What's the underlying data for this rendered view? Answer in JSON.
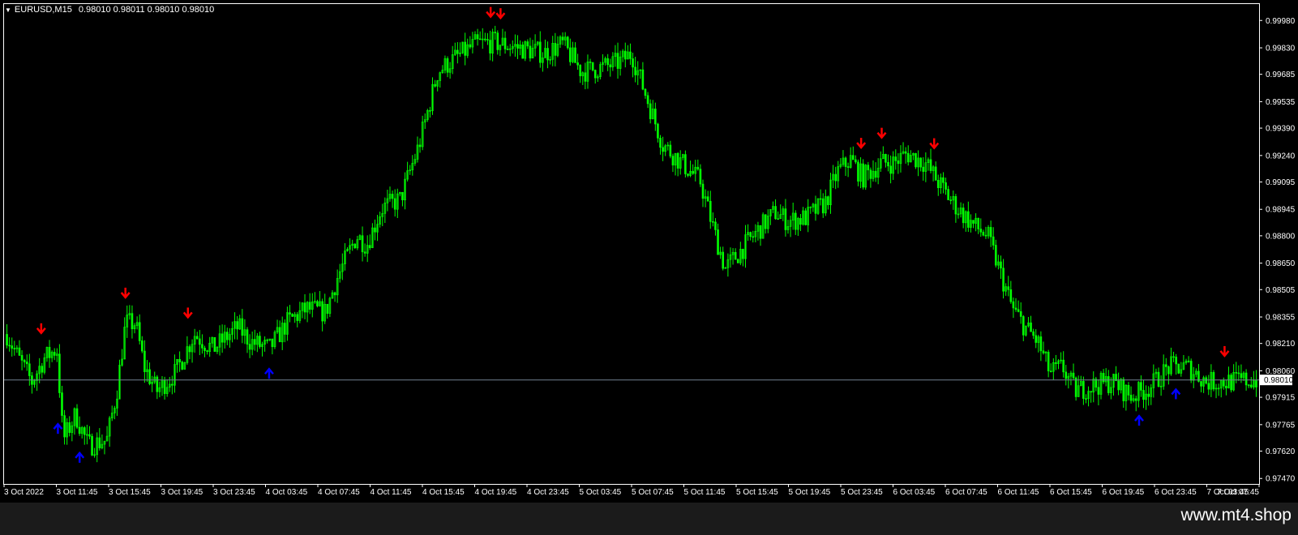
{
  "header": {
    "symbol_tf": "EURUSD,M15",
    "ohlc": "0.98010 0.98011 0.98010 0.98010"
  },
  "watermark": "www.mt4.shop",
  "colors": {
    "background": "#000000",
    "candle": "#00ff00",
    "sell_arrow": "#ff0000",
    "buy_arrow": "#0000ff",
    "current_line": "#708090",
    "axis": "#ffffff"
  },
  "chart_data": {
    "type": "candlestick",
    "current_price_label": "0.98010",
    "current_price": 0.9801,
    "ylim": [
      0.9744,
      1.0007
    ],
    "y_ticks": [
      "0.99980",
      "0.99830",
      "0.99685",
      "0.99535",
      "0.99390",
      "0.99240",
      "0.99095",
      "0.98945",
      "0.98800",
      "0.98650",
      "0.98505",
      "0.98355",
      "0.98210",
      "0.98060",
      "0.97915",
      "0.97765",
      "0.97620",
      "0.97470"
    ],
    "x_ticks": [
      "3 Oct 2022",
      "3 Oct 11:45",
      "3 Oct 15:45",
      "3 Oct 19:45",
      "3 Oct 23:45",
      "4 Oct 03:45",
      "4 Oct 07:45",
      "4 Oct 11:45",
      "4 Oct 15:45",
      "4 Oct 19:45",
      "4 Oct 23:45",
      "5 Oct 03:45",
      "5 Oct 07:45",
      "5 Oct 11:45",
      "5 Oct 15:45",
      "5 Oct 19:45",
      "5 Oct 23:45",
      "6 Oct 03:45",
      "6 Oct 07:45",
      "6 Oct 11:45",
      "6 Oct 15:45",
      "6 Oct 19:45",
      "6 Oct 23:45",
      "7 Oct 03:45",
      "7 Oct 07:45"
    ],
    "price_path": [
      [
        0.0,
        0.9826
      ],
      [
        0.01,
        0.9812
      ],
      [
        0.02,
        0.98
      ],
      [
        0.03,
        0.9813
      ],
      [
        0.04,
        0.9818
      ],
      [
        0.045,
        0.9768
      ],
      [
        0.055,
        0.9782
      ],
      [
        0.065,
        0.9765
      ],
      [
        0.08,
        0.9768
      ],
      [
        0.088,
        0.9795
      ],
      [
        0.095,
        0.9832
      ],
      [
        0.103,
        0.9832
      ],
      [
        0.11,
        0.9808
      ],
      [
        0.12,
        0.9795
      ],
      [
        0.135,
        0.9805
      ],
      [
        0.15,
        0.9826
      ],
      [
        0.165,
        0.9818
      ],
      [
        0.185,
        0.983
      ],
      [
        0.195,
        0.9822
      ],
      [
        0.21,
        0.9818
      ],
      [
        0.225,
        0.9833
      ],
      [
        0.24,
        0.984
      ],
      [
        0.255,
        0.9838
      ],
      [
        0.265,
        0.9858
      ],
      [
        0.28,
        0.988
      ],
      [
        0.288,
        0.9875
      ],
      [
        0.3,
        0.9895
      ],
      [
        0.315,
        0.99
      ],
      [
        0.33,
        0.993
      ],
      [
        0.345,
        0.997
      ],
      [
        0.36,
        0.9978
      ],
      [
        0.375,
        0.9985
      ],
      [
        0.39,
        0.9986
      ],
      [
        0.41,
        0.9983
      ],
      [
        0.43,
        0.998
      ],
      [
        0.445,
        0.9985
      ],
      [
        0.46,
        0.997
      ],
      [
        0.475,
        0.9972
      ],
      [
        0.49,
        0.9975
      ],
      [
        0.5,
        0.998
      ],
      [
        0.51,
        0.996
      ],
      [
        0.525,
        0.993
      ],
      [
        0.54,
        0.992
      ],
      [
        0.555,
        0.991
      ],
      [
        0.565,
        0.9885
      ],
      [
        0.575,
        0.9862
      ],
      [
        0.585,
        0.987
      ],
      [
        0.6,
        0.9882
      ],
      [
        0.615,
        0.9893
      ],
      [
        0.625,
        0.9888
      ],
      [
        0.64,
        0.989
      ],
      [
        0.655,
        0.9898
      ],
      [
        0.665,
        0.9915
      ],
      [
        0.675,
        0.9922
      ],
      [
        0.685,
        0.9912
      ],
      [
        0.7,
        0.992
      ],
      [
        0.71,
        0.992
      ],
      [
        0.72,
        0.9925
      ],
      [
        0.735,
        0.992
      ],
      [
        0.745,
        0.991
      ],
      [
        0.755,
        0.99
      ],
      [
        0.765,
        0.9892
      ],
      [
        0.775,
        0.9885
      ],
      [
        0.785,
        0.988
      ],
      [
        0.795,
        0.986
      ],
      [
        0.805,
        0.984
      ],
      [
        0.815,
        0.983
      ],
      [
        0.825,
        0.9822
      ],
      [
        0.835,
        0.9805
      ],
      [
        0.845,
        0.9808
      ],
      [
        0.855,
        0.9795
      ],
      [
        0.87,
        0.9798
      ],
      [
        0.885,
        0.98
      ],
      [
        0.9,
        0.9792
      ],
      [
        0.915,
        0.9797
      ],
      [
        0.93,
        0.9808
      ],
      [
        0.945,
        0.9808
      ],
      [
        0.96,
        0.98
      ],
      [
        0.975,
        0.98
      ],
      [
        1.0,
        0.9801
      ]
    ],
    "sell_arrows": [
      0.0296,
      0.0967,
      0.1465,
      0.3877,
      0.3956,
      0.6829,
      0.6993,
      0.7411,
      0.9725
    ],
    "buy_arrows": [
      0.0429,
      0.0602,
      0.2112,
      0.9044,
      0.9337
    ]
  }
}
